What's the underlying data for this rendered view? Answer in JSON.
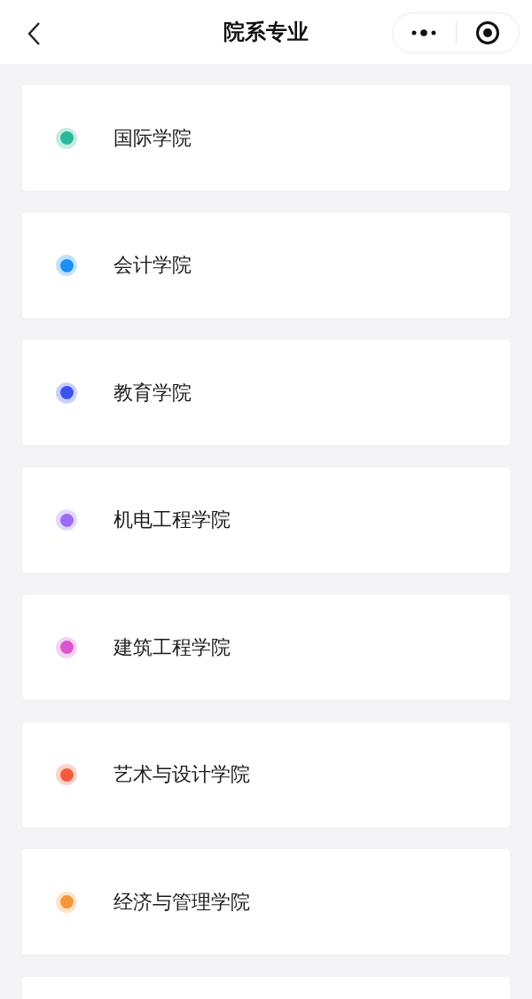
{
  "nav_bar": {
    "title": "院系专业"
  },
  "colleges": [
    {
      "name": "国际学院",
      "color": "#2bb89a"
    },
    {
      "name": "会计学院",
      "color": "#1e8ff5"
    },
    {
      "name": "教育学院",
      "color": "#3d50f0"
    },
    {
      "name": "机电工程学院",
      "color": "#9b6cf5"
    },
    {
      "name": "建筑工程学院",
      "color": "#dc55d0"
    },
    {
      "name": "艺术与设计学院",
      "color": "#f25c3c"
    },
    {
      "name": "经济与管理学院",
      "color": "#f7953a"
    }
  ]
}
